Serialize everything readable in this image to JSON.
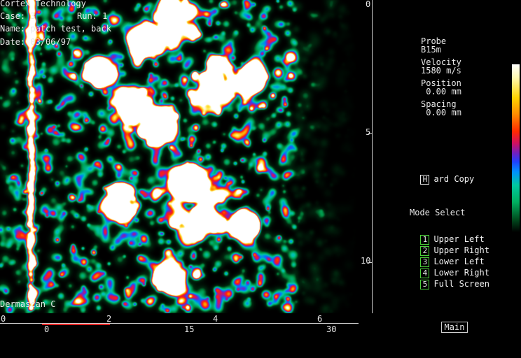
{
  "header": {
    "company": "Cortex Technology",
    "case": "Case: 3",
    "run": "Run: 1",
    "name": "Name: patch test, back",
    "date": "Date: 03/06/97"
  },
  "watermark": "Dermascan C",
  "depth_axis": {
    "labels": [
      "0",
      "5",
      "10"
    ]
  },
  "lateral_axis": {
    "top_labels": [
      "0",
      "2",
      "4",
      "6"
    ],
    "bottom_labels": [
      "0",
      "15",
      "30"
    ]
  },
  "info_panel": {
    "probe_label": "Probe",
    "probe_value": "B15m",
    "velocity_label": "Velocity",
    "velocity_value": "1580 m/s",
    "position_label": "Position",
    "position_value": " 0.00 mm",
    "spacing_label": "Spacing",
    "spacing_value": " 0.00 mm"
  },
  "hard_copy": {
    "key": "H",
    "label": "ard Copy"
  },
  "mode_select": {
    "title": "Mode Select",
    "items": [
      {
        "key": "1",
        "label": "Upper Left"
      },
      {
        "key": "2",
        "label": "Upper Right"
      },
      {
        "key": "3",
        "label": "Lower Left"
      },
      {
        "key": "4",
        "label": "Lower Right"
      },
      {
        "key": "5",
        "label": "Full Screen"
      }
    ]
  },
  "main_button": "Main",
  "colors": {
    "background": "#000000",
    "mode_key_border": "#4cd13a",
    "cursor_line": "#e02020"
  },
  "icons": [
    "hard-copy-key-icon",
    "mode-key-icon"
  ]
}
